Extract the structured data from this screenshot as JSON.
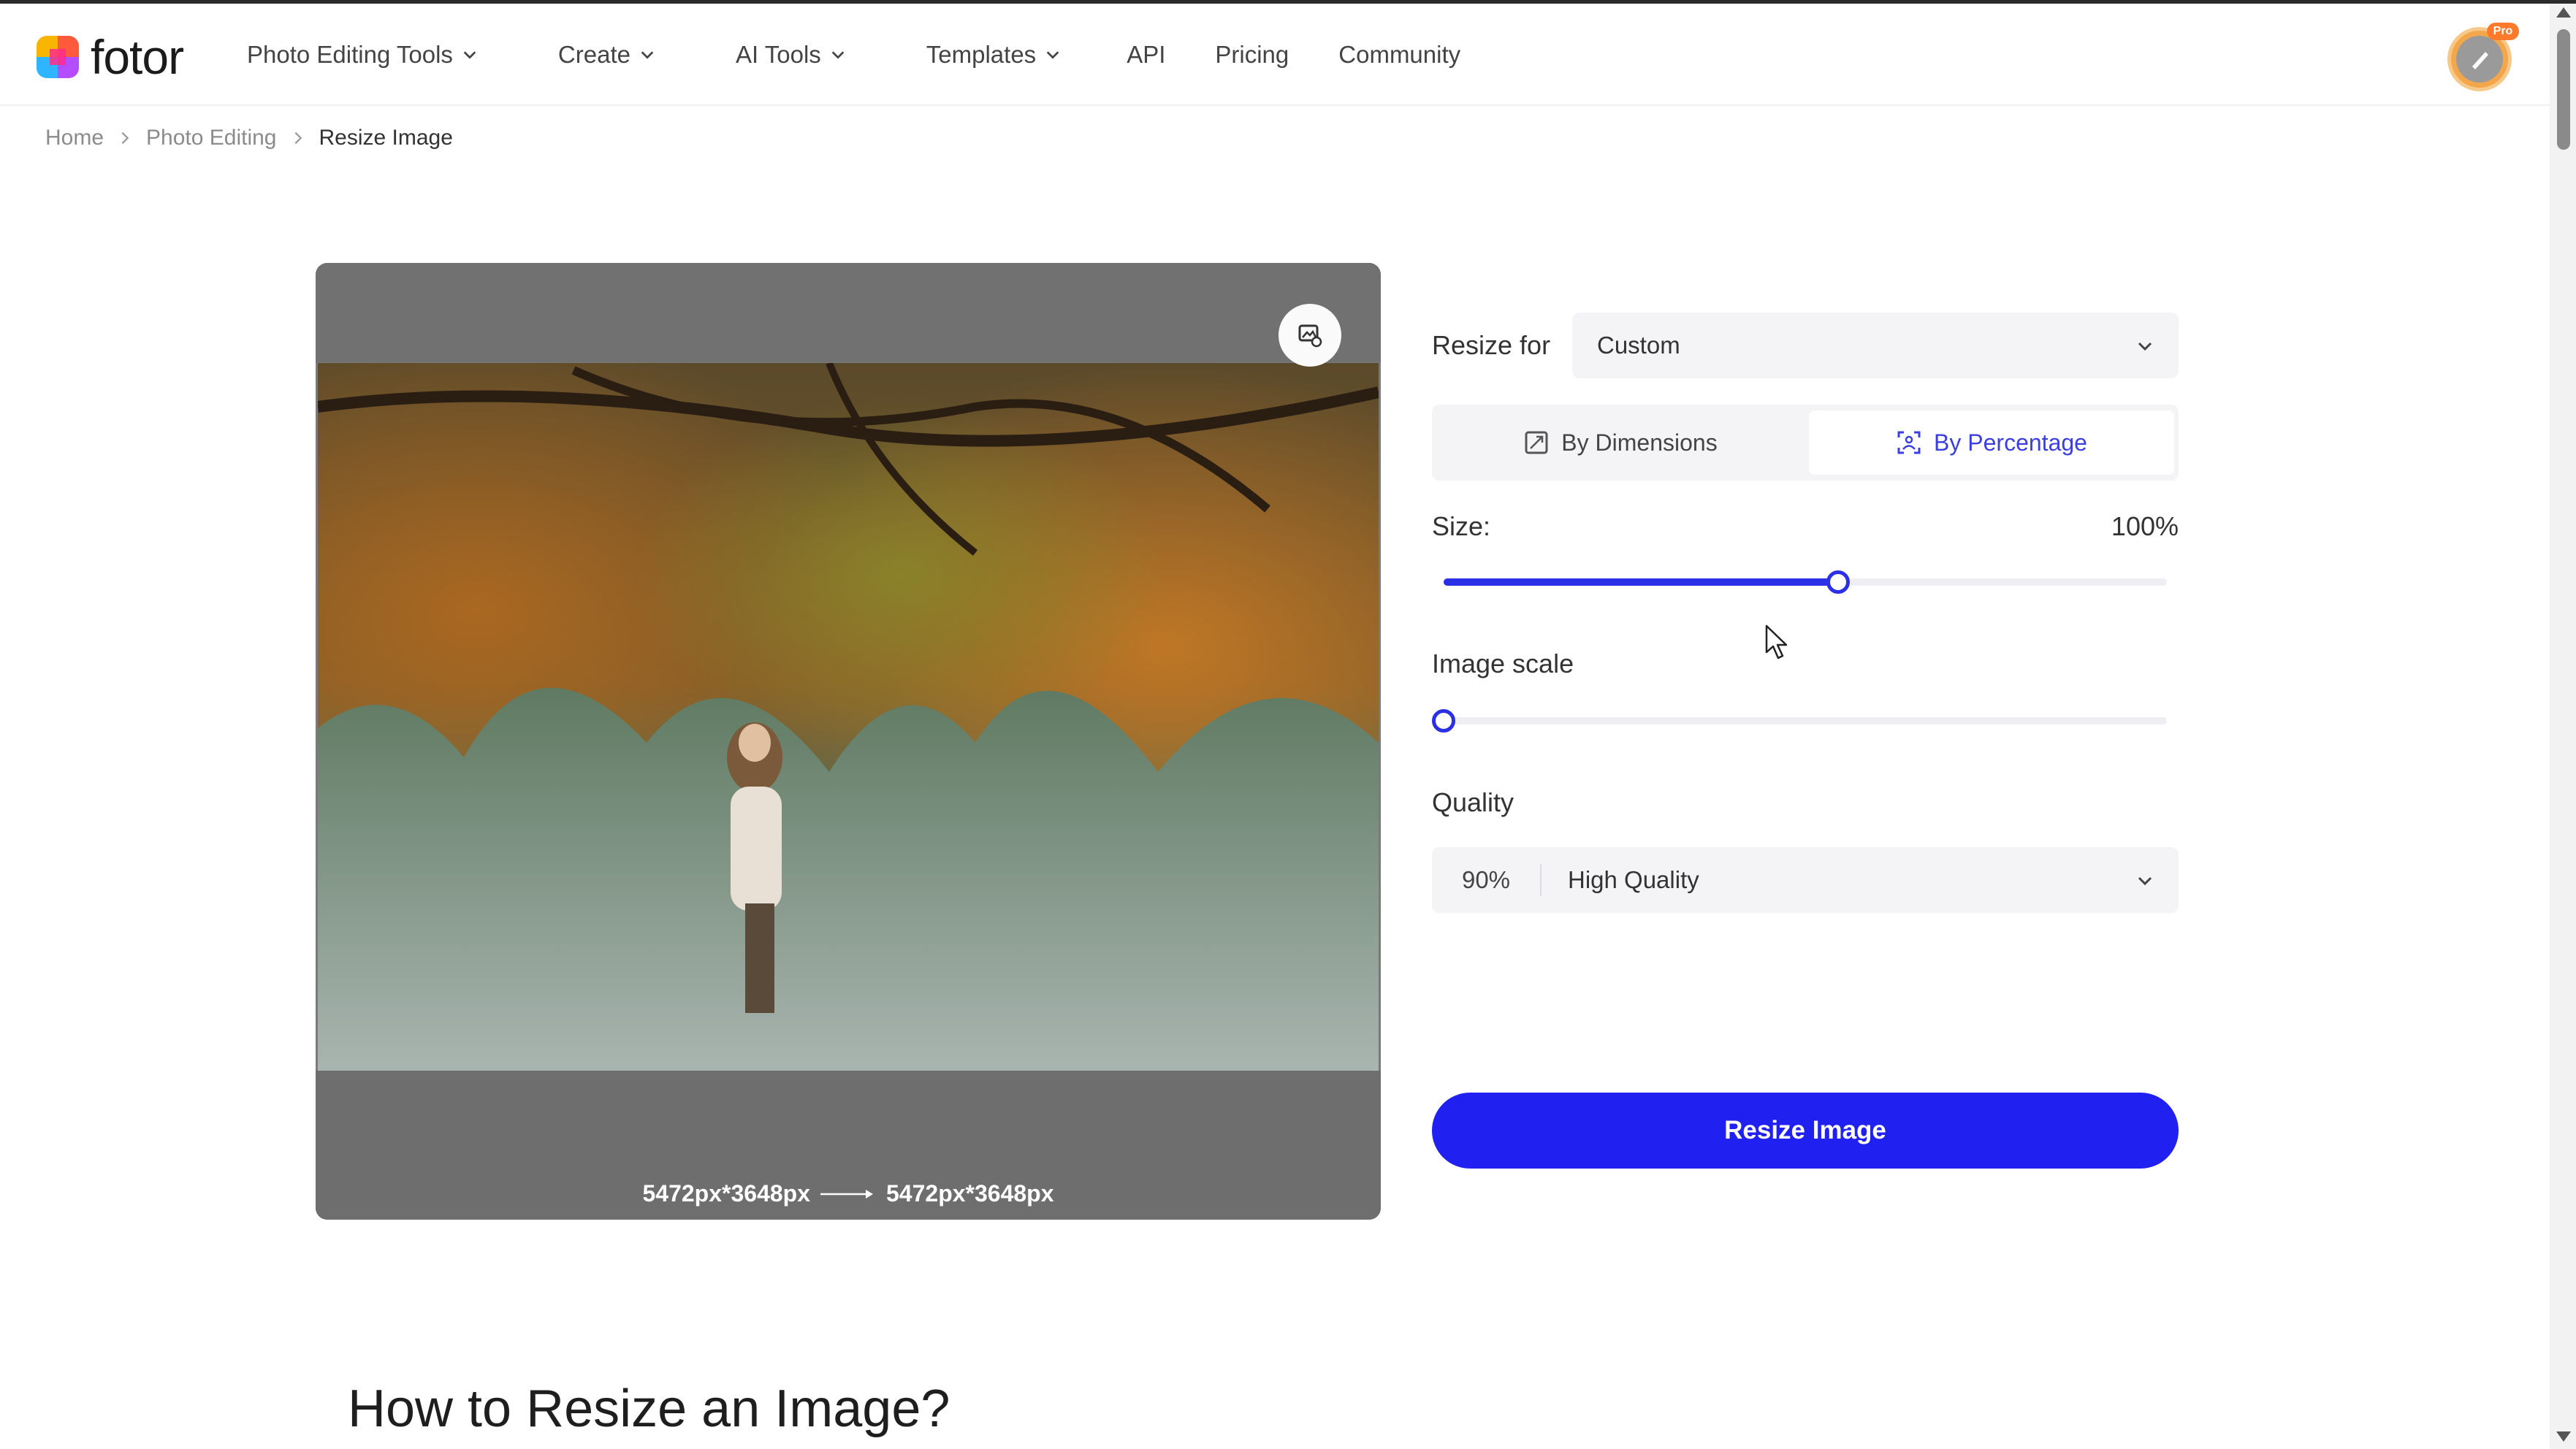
{
  "brand": {
    "name": "fotor"
  },
  "nav": {
    "items": [
      {
        "label": "Photo Editing Tools",
        "dropdown": true
      },
      {
        "label": "Create",
        "dropdown": true
      },
      {
        "label": "AI Tools",
        "dropdown": true
      },
      {
        "label": "Templates",
        "dropdown": true
      },
      {
        "label": "API",
        "dropdown": false
      },
      {
        "label": "Pricing",
        "dropdown": false
      },
      {
        "label": "Community",
        "dropdown": false
      }
    ],
    "pro_badge": "Pro"
  },
  "breadcrumb": {
    "items": [
      "Home",
      "Photo Editing",
      "Resize Image"
    ]
  },
  "preview": {
    "original_dims": "5472px*3648px",
    "new_dims": "5472px*3648px",
    "compare_icon": "compare-icon"
  },
  "controls": {
    "resize_for_label": "Resize for",
    "resize_for_value": "Custom",
    "tabs": [
      {
        "label": "By Dimensions",
        "icon": "dimensions-icon",
        "active": false
      },
      {
        "label": "By Percentage",
        "icon": "percentage-icon",
        "active": true
      }
    ],
    "size_label": "Size:",
    "size_value": "100%",
    "size_slider_fraction": 0.545,
    "image_scale_label": "Image scale",
    "image_scale_fraction": 0.0,
    "quality_label": "Quality",
    "quality_percent": "90%",
    "quality_value": "High Quality",
    "resize_button": "Resize Image"
  },
  "section": {
    "heading": "How to Resize an Image?"
  },
  "colors": {
    "accent": "#2020f0",
    "tab_active_text": "#3b3fe0",
    "panel_gray": "#7a7a7a"
  }
}
